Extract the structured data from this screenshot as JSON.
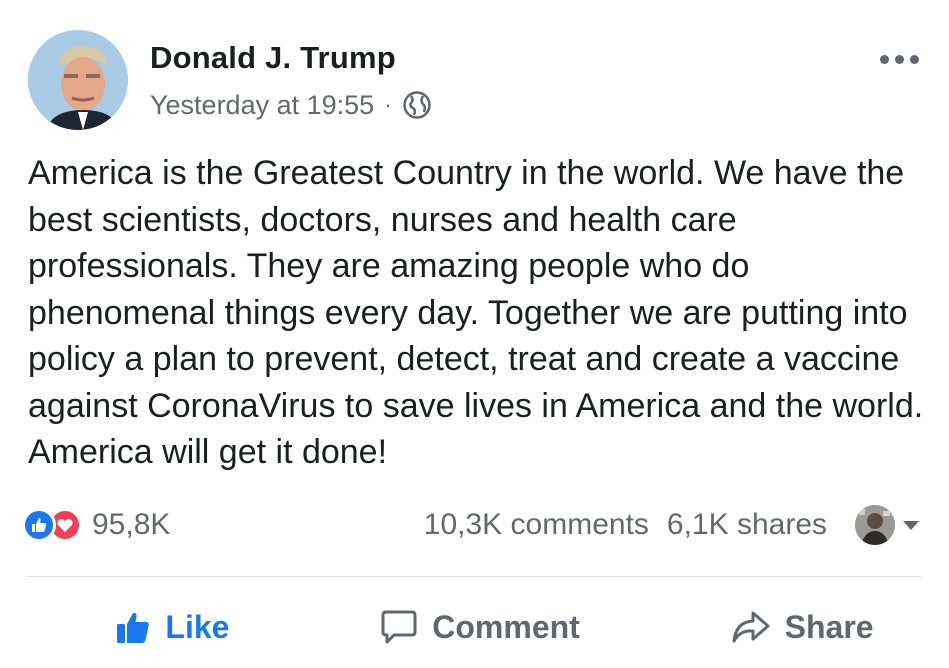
{
  "post": {
    "author": "Donald J. Trump",
    "timestamp": "Yesterday at 19:55",
    "separator": "·",
    "audience_icon": "globe-icon",
    "body": "America is the Greatest Country in the world. We have the best scientists, doctors, nurses and health care professionals. They are amazing people who do phenomenal things every day. Together we are putting into policy a plan to prevent, detect, treat and create a vaccine against CoronaVirus to save lives in America and the world. America will get it done!",
    "reactions": {
      "icons": [
        "like-icon",
        "love-icon"
      ],
      "count": "95,8K"
    },
    "comments": "10,3K comments",
    "shares": "6,1K shares"
  },
  "actions": {
    "like": "Like",
    "comment": "Comment",
    "share": "Share"
  },
  "colors": {
    "like_blue": "#1877f2",
    "love_red": "#f33e58",
    "secondary_text": "#65676b"
  }
}
